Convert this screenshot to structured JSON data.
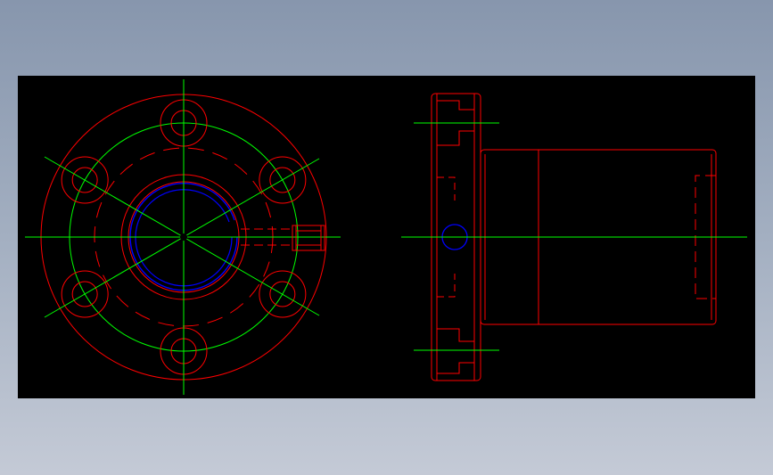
{
  "drawing": {
    "title": "",
    "colors": {
      "background": "#000000",
      "page_gradient_top": "#8796ad",
      "page_gradient_bottom": "#c4cad6",
      "outline": "#ff0000",
      "centerline": "#00ff00",
      "thread": "#0000ff"
    },
    "views": [
      {
        "name": "front-view",
        "description_shown": false
      },
      {
        "name": "side-view",
        "description_shown": false
      }
    ],
    "front_view": {
      "bolt_hole_count": 6
    }
  }
}
